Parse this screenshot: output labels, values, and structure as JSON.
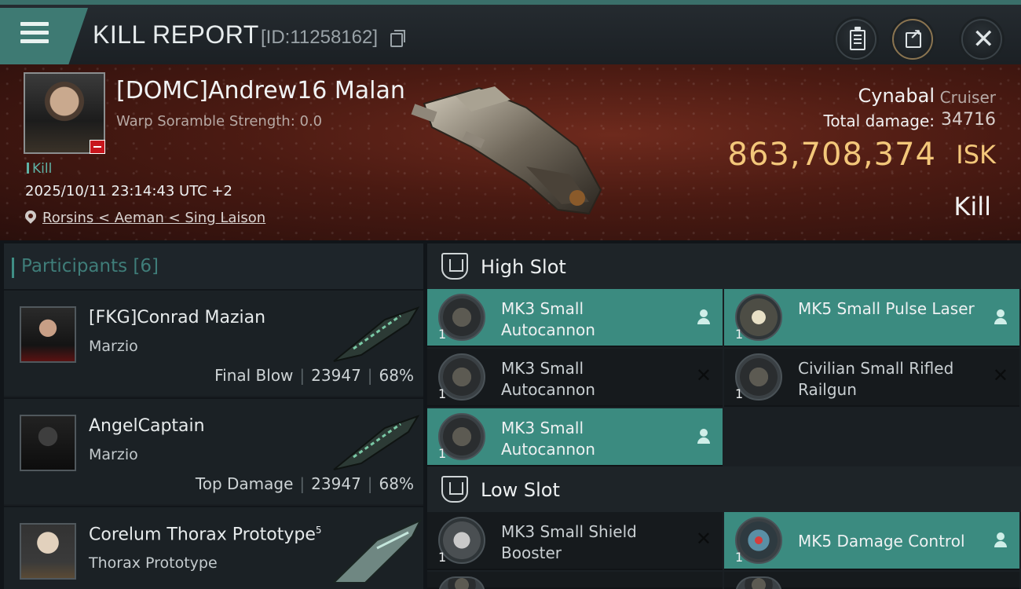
{
  "header": {
    "title": "KILL REPORT",
    "report_id": "[ID:11258162]"
  },
  "victim": {
    "name": "[DOMC]Andrew16 Malan",
    "scramble": "Warp Soramble Strength: 0.0",
    "tag": "Kill",
    "timestamp": "2025/10/11 23:14:43 UTC +2",
    "location": "Rorsins < Aeman < Sing Laison",
    "ship_name": "Cynabal",
    "ship_class": "Cruiser",
    "total_damage_label": "Total damage:",
    "total_damage": "34716",
    "isk_value": "863,708,374",
    "isk_unit": "ISK",
    "result": "Kill"
  },
  "participants": {
    "header": "Participants [6]",
    "rows": [
      {
        "name": "[FKG]Conrad Mazian",
        "corp": "Marzio",
        "role": "Final Blow",
        "damage": "23947",
        "percent": "68%"
      },
      {
        "name": "AngelCaptain",
        "corp": "Marzio",
        "role": "Top Damage",
        "damage": "23947",
        "percent": "68%"
      },
      {
        "name": "Corelum Thorax Prototype",
        "sup": "5",
        "corp": "Thorax Prototype"
      }
    ]
  },
  "fitting": {
    "high_slot_title": "High Slot",
    "low_slot_title": "Low Slot",
    "high": [
      {
        "name": "MK3 Small Autocannon",
        "qty": "1",
        "state": "dropped"
      },
      {
        "name": "MK5 Small Pulse Laser",
        "qty": "1",
        "state": "dropped"
      },
      {
        "name": "MK3 Small Autocannon",
        "qty": "1",
        "state": "destroyed"
      },
      {
        "name": "Civilian Small Rifled Railgun",
        "qty": "1",
        "state": "destroyed"
      },
      {
        "name": "MK3 Small Autocannon",
        "qty": "1",
        "state": "dropped"
      }
    ],
    "low": [
      {
        "name": "MK3 Small Shield Booster",
        "qty": "1",
        "state": "destroyed"
      },
      {
        "name": "MK5 Damage Control",
        "qty": "1",
        "state": "dropped"
      }
    ]
  }
}
